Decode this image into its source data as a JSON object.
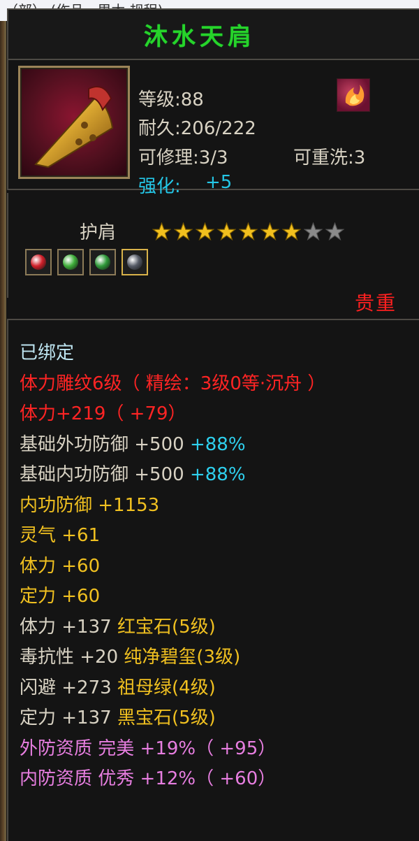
{
  "page_header": "（部） (作品 · 里木 规程)",
  "item": {
    "name": "沐水天肩",
    "level": "等级:88",
    "durability": "耐久:206/222",
    "repair": "可修理:3/3",
    "rewash": "可重洗:3",
    "enhance_label": "强化:",
    "enhance_value": "+5",
    "slot": "护肩",
    "stars_filled": 7,
    "stars_total": 9,
    "rarity": "贵重",
    "icon": "golden-shoulder-pad-icon",
    "skill_icon": "flame-skill-icon"
  },
  "gems": [
    {
      "name": "red-gem-icon",
      "color": "#d0202a"
    },
    {
      "name": "green-gem-icon",
      "color": "#3fae3a"
    },
    {
      "name": "green-jade-gem-icon",
      "color": "#2f9a3a"
    },
    {
      "name": "black-gem-icon",
      "color": "#555a66"
    }
  ],
  "attributes": [
    {
      "parts": [
        {
          "t": "已绑定",
          "c": "ltcyan"
        }
      ]
    },
    {
      "parts": [
        {
          "t": "体力雕纹6级（ 精绘：3级0等·沉舟 ）",
          "c": "red"
        }
      ]
    },
    {
      "parts": [
        {
          "t": "体力+219（ +79）",
          "c": "red"
        }
      ]
    },
    {
      "parts": [
        {
          "t": "基础外功防御 +500 ",
          "c": "white"
        },
        {
          "t": "+88%",
          "c": "cyan2"
        }
      ]
    },
    {
      "parts": [
        {
          "t": "基础内功防御 +500 ",
          "c": "white"
        },
        {
          "t": "+88%",
          "c": "cyan2"
        }
      ]
    },
    {
      "parts": [
        {
          "t": "内功防御 +1153",
          "c": "yellow"
        }
      ]
    },
    {
      "parts": [
        {
          "t": "灵气 +61",
          "c": "yellow"
        }
      ]
    },
    {
      "parts": [
        {
          "t": "体力 +60",
          "c": "yellow"
        }
      ]
    },
    {
      "parts": [
        {
          "t": "定力 +60",
          "c": "yellow"
        }
      ]
    },
    {
      "parts": [
        {
          "t": "体力 +137 ",
          "c": "white"
        },
        {
          "t": "红宝石(5级)",
          "c": "yellow"
        }
      ]
    },
    {
      "parts": [
        {
          "t": "毒抗性 +20 ",
          "c": "white"
        },
        {
          "t": "纯净碧玺(3级)",
          "c": "yellow"
        }
      ]
    },
    {
      "parts": [
        {
          "t": "闪避 +273 ",
          "c": "white"
        },
        {
          "t": "祖母绿(4级)",
          "c": "yellow"
        }
      ]
    },
    {
      "parts": [
        {
          "t": "定力 +137 ",
          "c": "white"
        },
        {
          "t": "黑宝石(5级)",
          "c": "yellow"
        }
      ]
    },
    {
      "parts": [
        {
          "t": "外防资质 完美 +19%（ +95）",
          "c": "pink"
        }
      ]
    },
    {
      "parts": [
        {
          "t": "内防资质 优秀 +12%（ +60）",
          "c": "pink"
        }
      ]
    }
  ]
}
